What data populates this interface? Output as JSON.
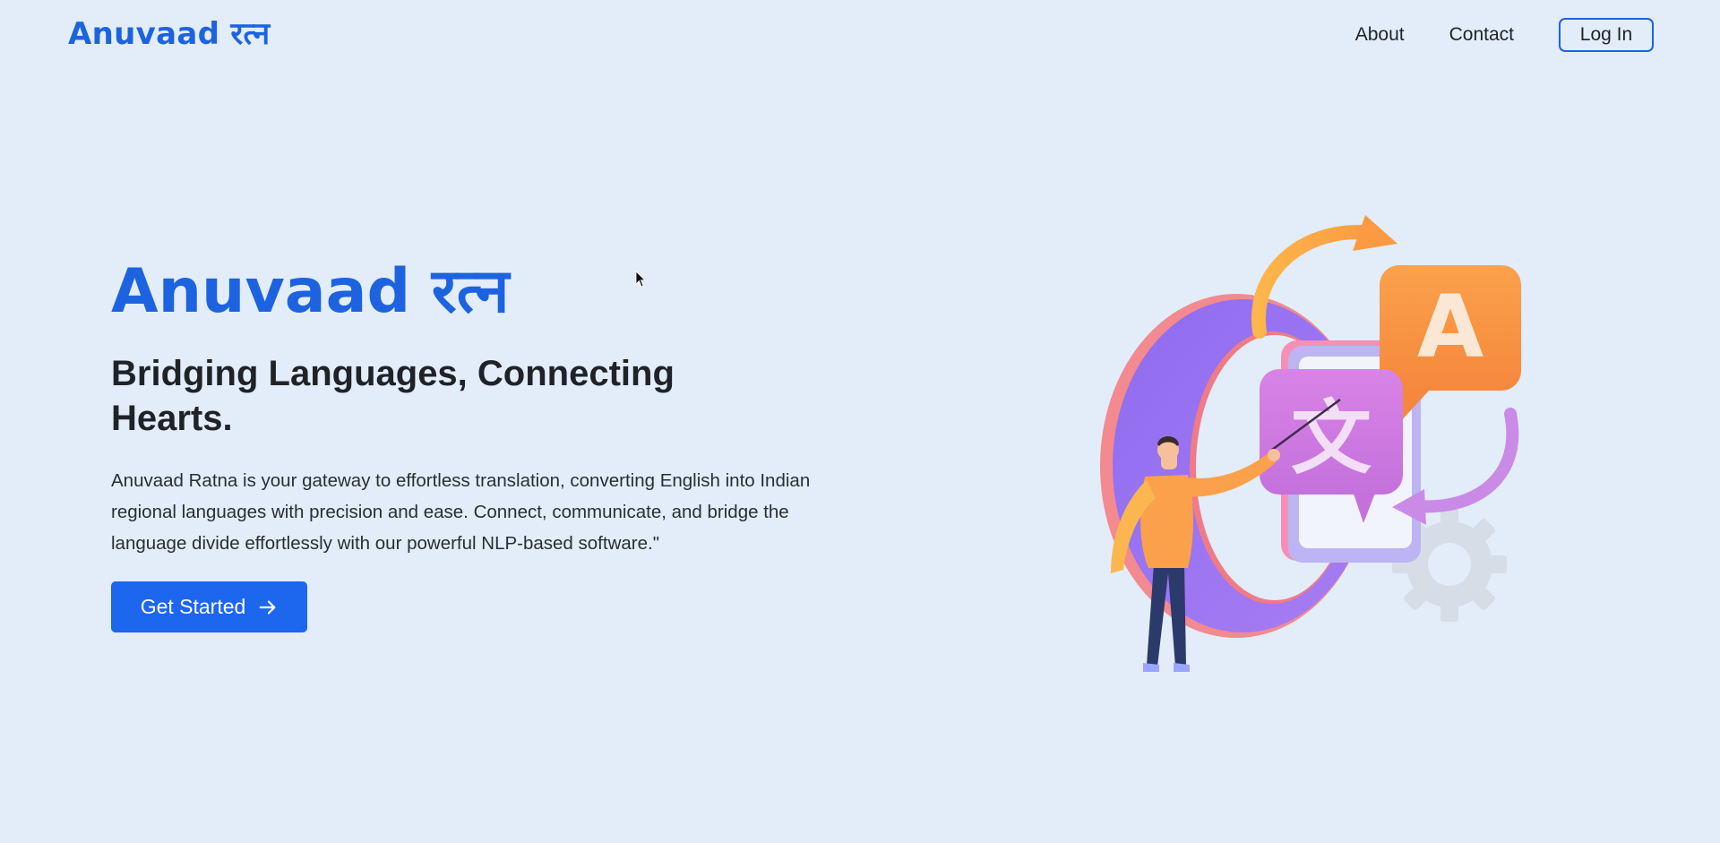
{
  "navbar": {
    "brand": "Anuvaad रत्न",
    "links": {
      "about": "About",
      "contact": "Contact"
    },
    "login_label": "Log In"
  },
  "hero": {
    "title": "Anuvaad रत्न",
    "subtitle": "Bridging Languages, Connecting Hearts.",
    "description": "Anuvaad Ratna is your gateway to effortless translation, converting English into Indian regional languages with precision and ease. Connect, communicate, and bridge the language divide effortlessly with our powerful NLP-based software.\"",
    "cta_label": "Get Started",
    "cta_icon": "arrow-right-icon"
  },
  "illustration": {
    "glyph_latin": "A",
    "glyph_cjk": "文",
    "icons": [
      "person-presenting-icon",
      "translate-bubble-icon",
      "gear-icon",
      "cycle-arrows-icon"
    ]
  },
  "colors": {
    "background": "#e2edf9",
    "brand_blue": "#1d63e0",
    "cta_blue": "#1d66ee",
    "text_dark": "#1f2328"
  }
}
